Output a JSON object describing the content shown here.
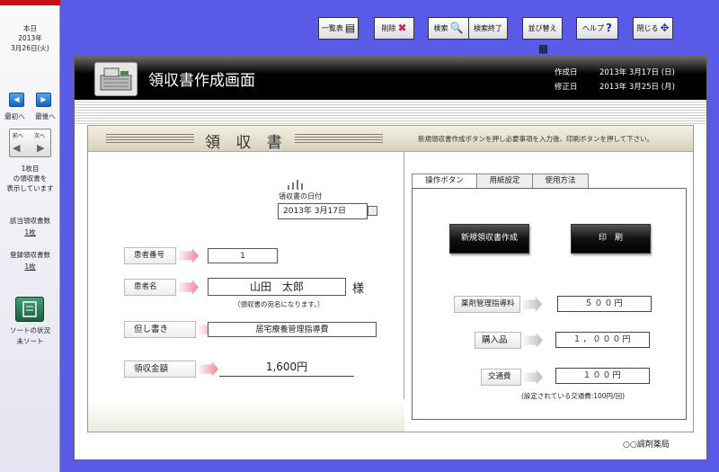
{
  "sidebar": {
    "today_label": "本日",
    "today_year": "2013年",
    "today_date": "3月26日(火)",
    "first_label": "最初へ",
    "last_label": "最後へ",
    "prev_label": "前へ",
    "next_label": "次へ",
    "page_line1": "1枚目",
    "page_line2": "の領収書を",
    "page_line3": "表示しています",
    "matching_count_label": "該当領収書数",
    "matching_count_value": "1枚",
    "registered_count_label": "登録領収書数",
    "registered_count_value": "1枚",
    "sort_status_label": "ソートの状況",
    "sort_status_value": "未ソート"
  },
  "toolbar": {
    "list": "一覧表",
    "delete": "削除",
    "search": "検索",
    "search_end": "検索終了",
    "sort": "並び替え",
    "help": "ヘルプ",
    "close": "閉じる"
  },
  "header": {
    "title": "領収書作成画面",
    "created_label": "作成日",
    "created_value": "2013年 3月17日 (日)",
    "modified_label": "修正日",
    "modified_value": "2013年 3月25日 (月)"
  },
  "panel": {
    "title": "領 収 書",
    "instructions": "新規領収書作成ボタンを押し必要事項を入力後、印刷ボタンを押して下さい。"
  },
  "form": {
    "date_label": "領収書の日付",
    "date_value": "2013年 3月17日",
    "patient_number_label": "患者番号",
    "patient_number_value": "1",
    "patient_name_label": "患者名",
    "patient_name_value": "山田　太郎",
    "honorific": "様",
    "name_note": "（領収書の宛名になります。）",
    "description_label": "但し書き",
    "description_value": "居宅療養管理指導費",
    "amount_label": "領収金額",
    "amount_value": "1,600円"
  },
  "tabs": [
    "操作ボタン",
    "用紙設定",
    "使用方法"
  ],
  "operations": {
    "new_button": "新規領収書作成",
    "print_button": "印　刷",
    "guidance_fee_label": "薬剤管理指導料",
    "guidance_fee_value": "５００円",
    "purchase_label": "購入品",
    "purchase_value": "１，０００円",
    "transport_label": "交通費",
    "transport_value": "１００円",
    "transport_note": "(設定されている交通費:100円/回)"
  },
  "footer": {
    "pharmacy": "○○調剤薬局"
  }
}
